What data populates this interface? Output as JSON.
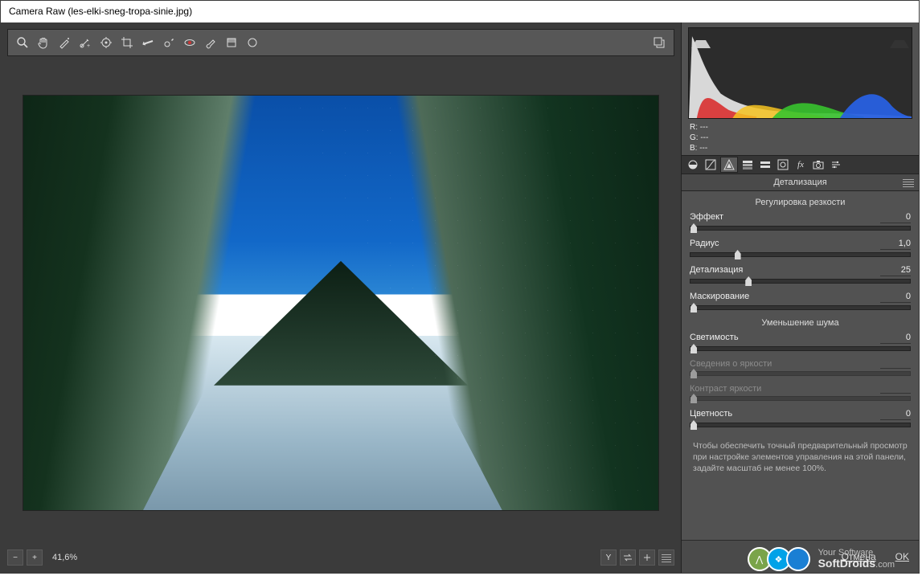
{
  "window": {
    "title": "Camera Raw (les-elki-sneg-tropa-sinie.jpg)"
  },
  "toolbar_icons": [
    "zoom",
    "hand",
    "white-balance",
    "color-sampler",
    "target-adjust",
    "crop",
    "straighten",
    "spot",
    "redeye",
    "brush",
    "grad",
    "radial"
  ],
  "zoom": {
    "minus": "−",
    "plus": "+",
    "value": "41,6%"
  },
  "readout": {
    "R": "R:    ---",
    "G": "G:    ---",
    "B": "B:    ---"
  },
  "panel": {
    "title": "Детализация",
    "sections": {
      "sharpen": {
        "heading": "Регулировка резкости",
        "sliders": [
          {
            "label": "Эффект",
            "value": "0",
            "pos": 0,
            "disabled": false
          },
          {
            "label": "Радиус",
            "value": "1,0",
            "pos": 20,
            "disabled": false
          },
          {
            "label": "Детализация",
            "value": "25",
            "pos": 25,
            "disabled": false
          },
          {
            "label": "Маскирование",
            "value": "0",
            "pos": 0,
            "disabled": false
          }
        ]
      },
      "noise": {
        "heading": "Уменьшение шума",
        "sliders": [
          {
            "label": "Светимость",
            "value": "0",
            "pos": 0,
            "disabled": false
          },
          {
            "label": "Сведения о яркости",
            "value": "",
            "pos": 0,
            "disabled": true
          },
          {
            "label": "Контраст яркости",
            "value": "",
            "pos": 0,
            "disabled": true
          },
          {
            "label": "Цветность",
            "value": "0",
            "pos": 0,
            "disabled": false
          }
        ]
      }
    },
    "hint": "Чтобы обеспечить точный предварительный просмотр при настройке элементов управления на этой панели, задайте масштаб не менее 100%."
  },
  "footer": {
    "cancel": "Отмена",
    "ok": "OK"
  },
  "watermark": {
    "line1": "Your Software",
    "brand": "SoftDroids",
    "suffix": ".com"
  },
  "colors": {
    "accent_green": "#7aa44a",
    "accent_blue": "#1a7fd4",
    "accent_win": "#00a2e8"
  }
}
